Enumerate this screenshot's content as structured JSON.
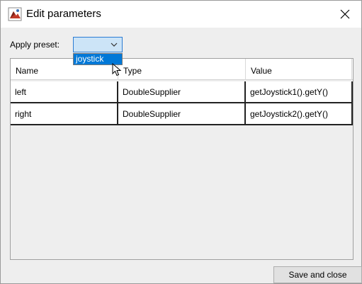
{
  "window": {
    "title": "Edit parameters"
  },
  "preset": {
    "label": "Apply preset:",
    "selected_value": "",
    "options": [
      "joystick"
    ]
  },
  "table": {
    "columns": [
      "Name",
      "Type",
      "Value"
    ],
    "rows": [
      [
        "left",
        "DoubleSupplier",
        "getJoystick1().getY()"
      ],
      [
        "right",
        "DoubleSupplier",
        "getJoystick2().getY()"
      ]
    ]
  },
  "footer": {
    "save_label": "Save and close"
  },
  "icons": {
    "app": "java-app-icon",
    "close": "close-icon",
    "dropdown": "chevron-down-icon",
    "cursor": "mouse-pointer-icon"
  },
  "colors": {
    "selection": "#0078d7",
    "combo_bg": "#cce4f7",
    "combo_border": "#2b7cd3"
  }
}
